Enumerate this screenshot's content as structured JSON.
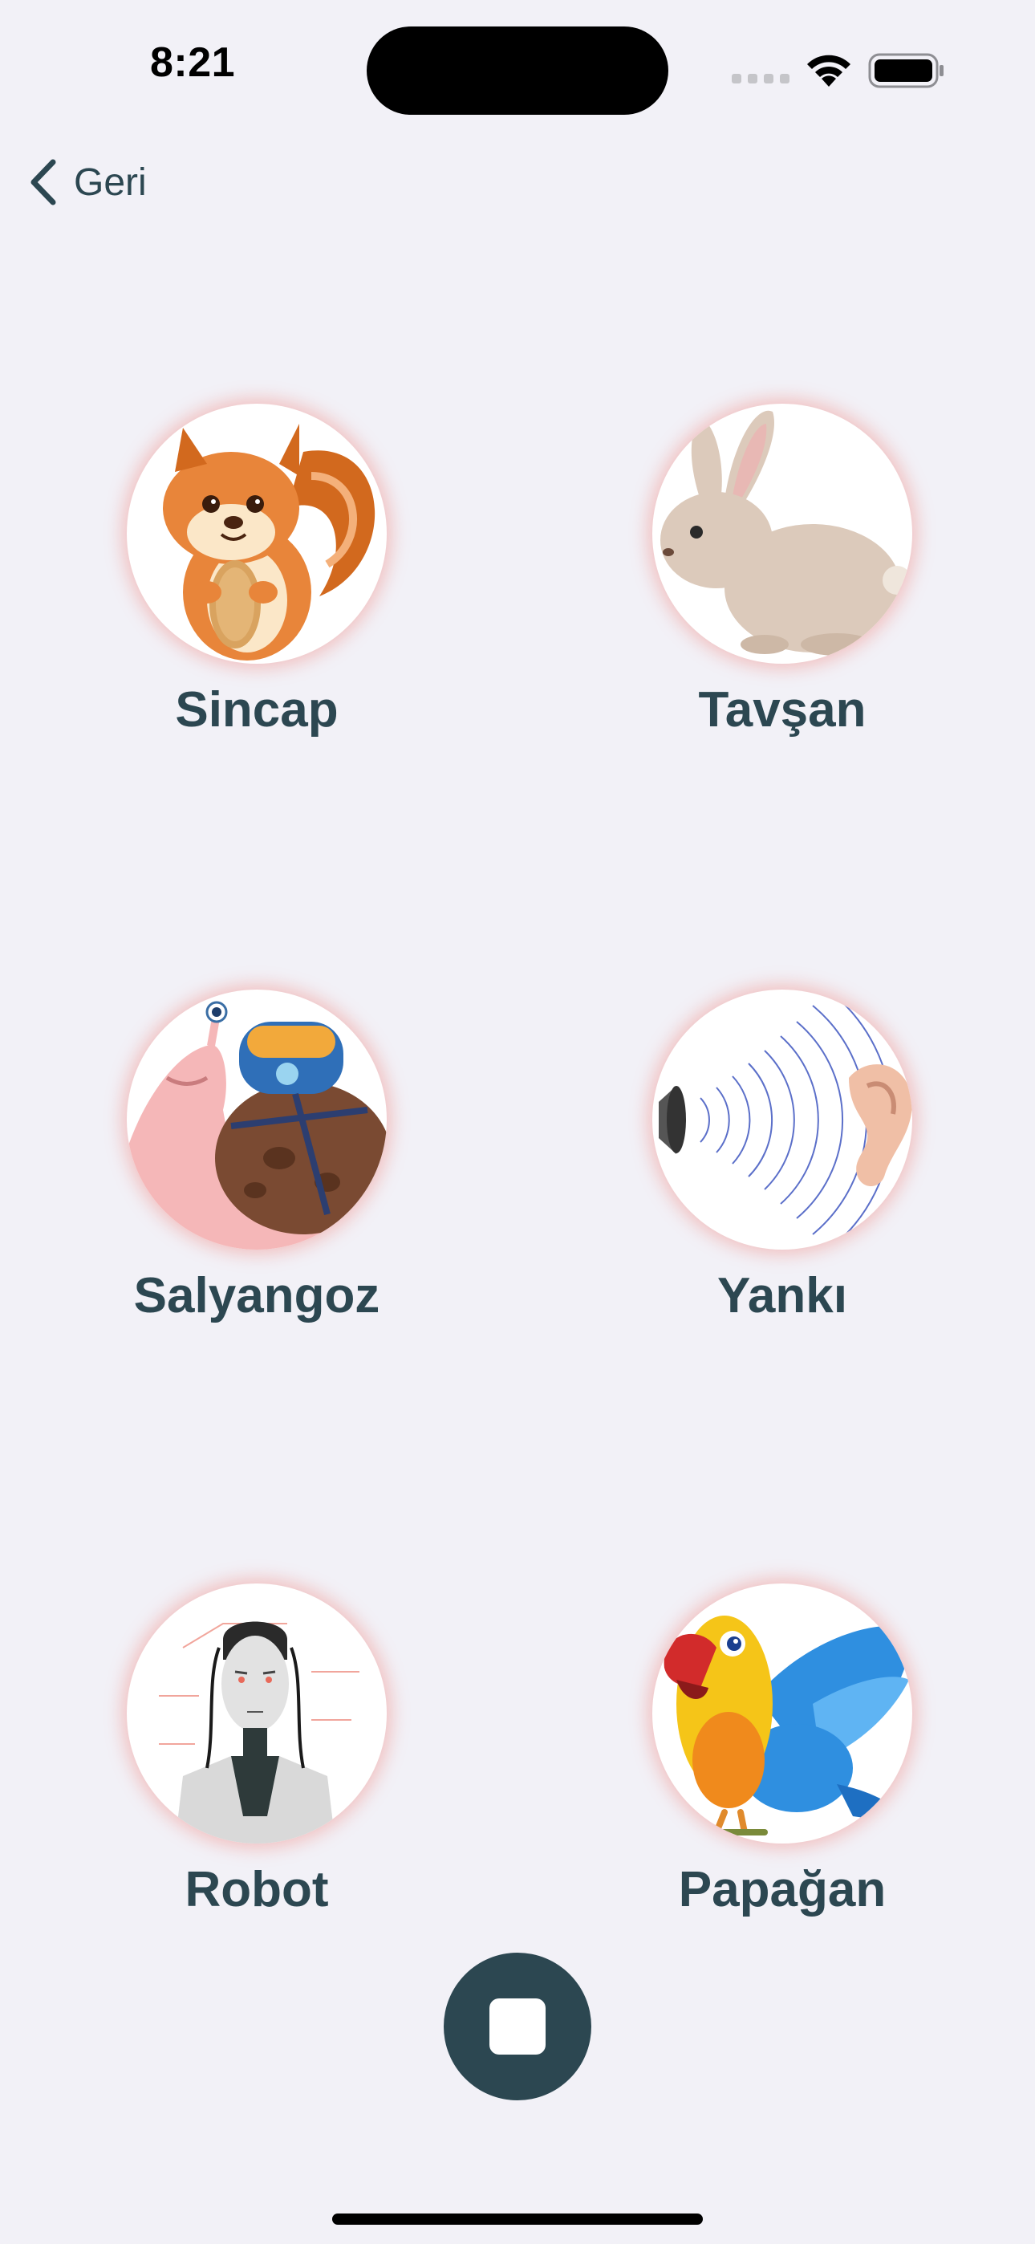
{
  "status_bar": {
    "time": "8:21",
    "icons": [
      "signal-icon",
      "wifi-icon",
      "battery-icon"
    ]
  },
  "nav": {
    "back_label": "Geri",
    "back_icon": "chevron-left-icon"
  },
  "effects": [
    {
      "id": "sincap",
      "label": "Sincap",
      "icon": "squirrel-icon"
    },
    {
      "id": "tavsan",
      "label": "Tavşan",
      "icon": "rabbit-icon"
    },
    {
      "id": "salyangoz",
      "label": "Salyangoz",
      "icon": "snail-icon"
    },
    {
      "id": "yanki",
      "label": "Yankı",
      "icon": "echo-icon"
    },
    {
      "id": "robot",
      "label": "Robot",
      "icon": "robot-icon"
    },
    {
      "id": "papagan",
      "label": "Papağan",
      "icon": "parrot-icon"
    }
  ],
  "controls": {
    "stop_icon": "stop-icon"
  },
  "colors": {
    "background": "#f2f1f7",
    "primary": "#2c4751",
    "circle_glow": "#f0786e"
  }
}
